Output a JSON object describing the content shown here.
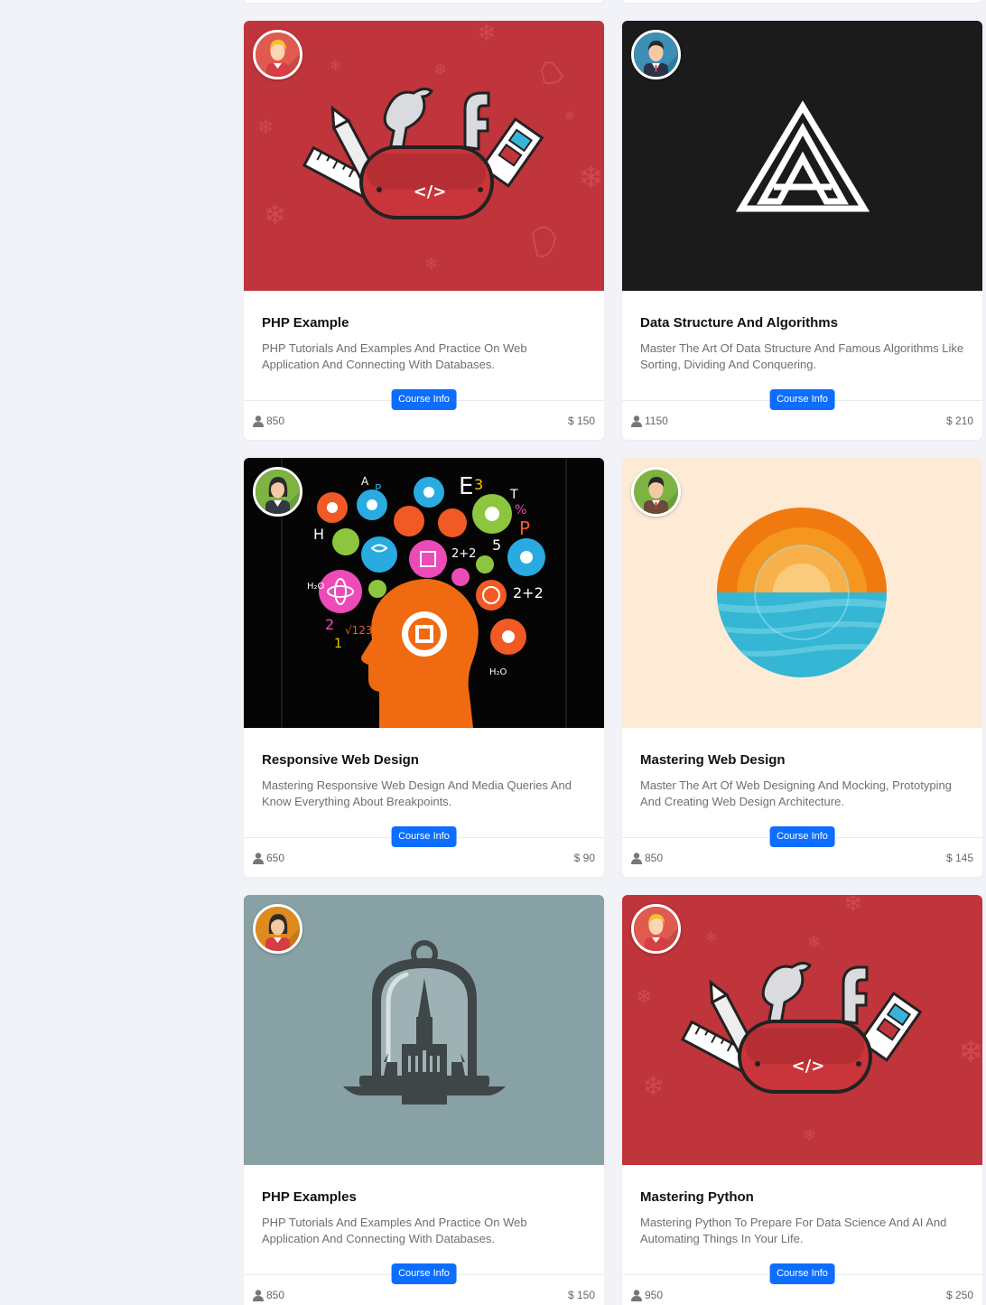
{
  "courses": [
    {
      "title": "PHP Example",
      "description": "PHP Tutorials And Examples And Practice On Web Application And Connecting With Databases.",
      "button": "Course Info",
      "students": "850",
      "price": "$ 150"
    },
    {
      "title": "Data Structure And Algorithms",
      "description": "Master The Art Of Data Structure And Famous Algorithms Like Sorting, Dividing And Conquering.",
      "button": "Course Info",
      "students": "1150",
      "price": "$ 210"
    },
    {
      "title": "Responsive Web Design",
      "description": "Mastering Responsive Web Design And Media Queries And Know Everything About Breakpoints.",
      "button": "Course Info",
      "students": "650",
      "price": "$ 90"
    },
    {
      "title": "Mastering Web Design",
      "description": "Master The Art Of Web Designing And Mocking, Prototyping And Creating Web Design Architecture.",
      "button": "Course Info",
      "students": "850",
      "price": "$ 145"
    },
    {
      "title": "PHP Examples",
      "description": "PHP Tutorials And Examples And Practice On Web Application And Connecting With Databases.",
      "button": "Course Info",
      "students": "850",
      "price": "$ 150"
    },
    {
      "title": "Mastering Python",
      "description": "Mastering Python To Prepare For Data Science And AI And Automating Things In Your Life.",
      "button": "Course Info",
      "students": "950",
      "price": "$ 250"
    }
  ],
  "colors": {
    "accent": "#0d6efd",
    "page_bg": "#f1f3f8"
  },
  "icons": {
    "students": "user-icon"
  }
}
